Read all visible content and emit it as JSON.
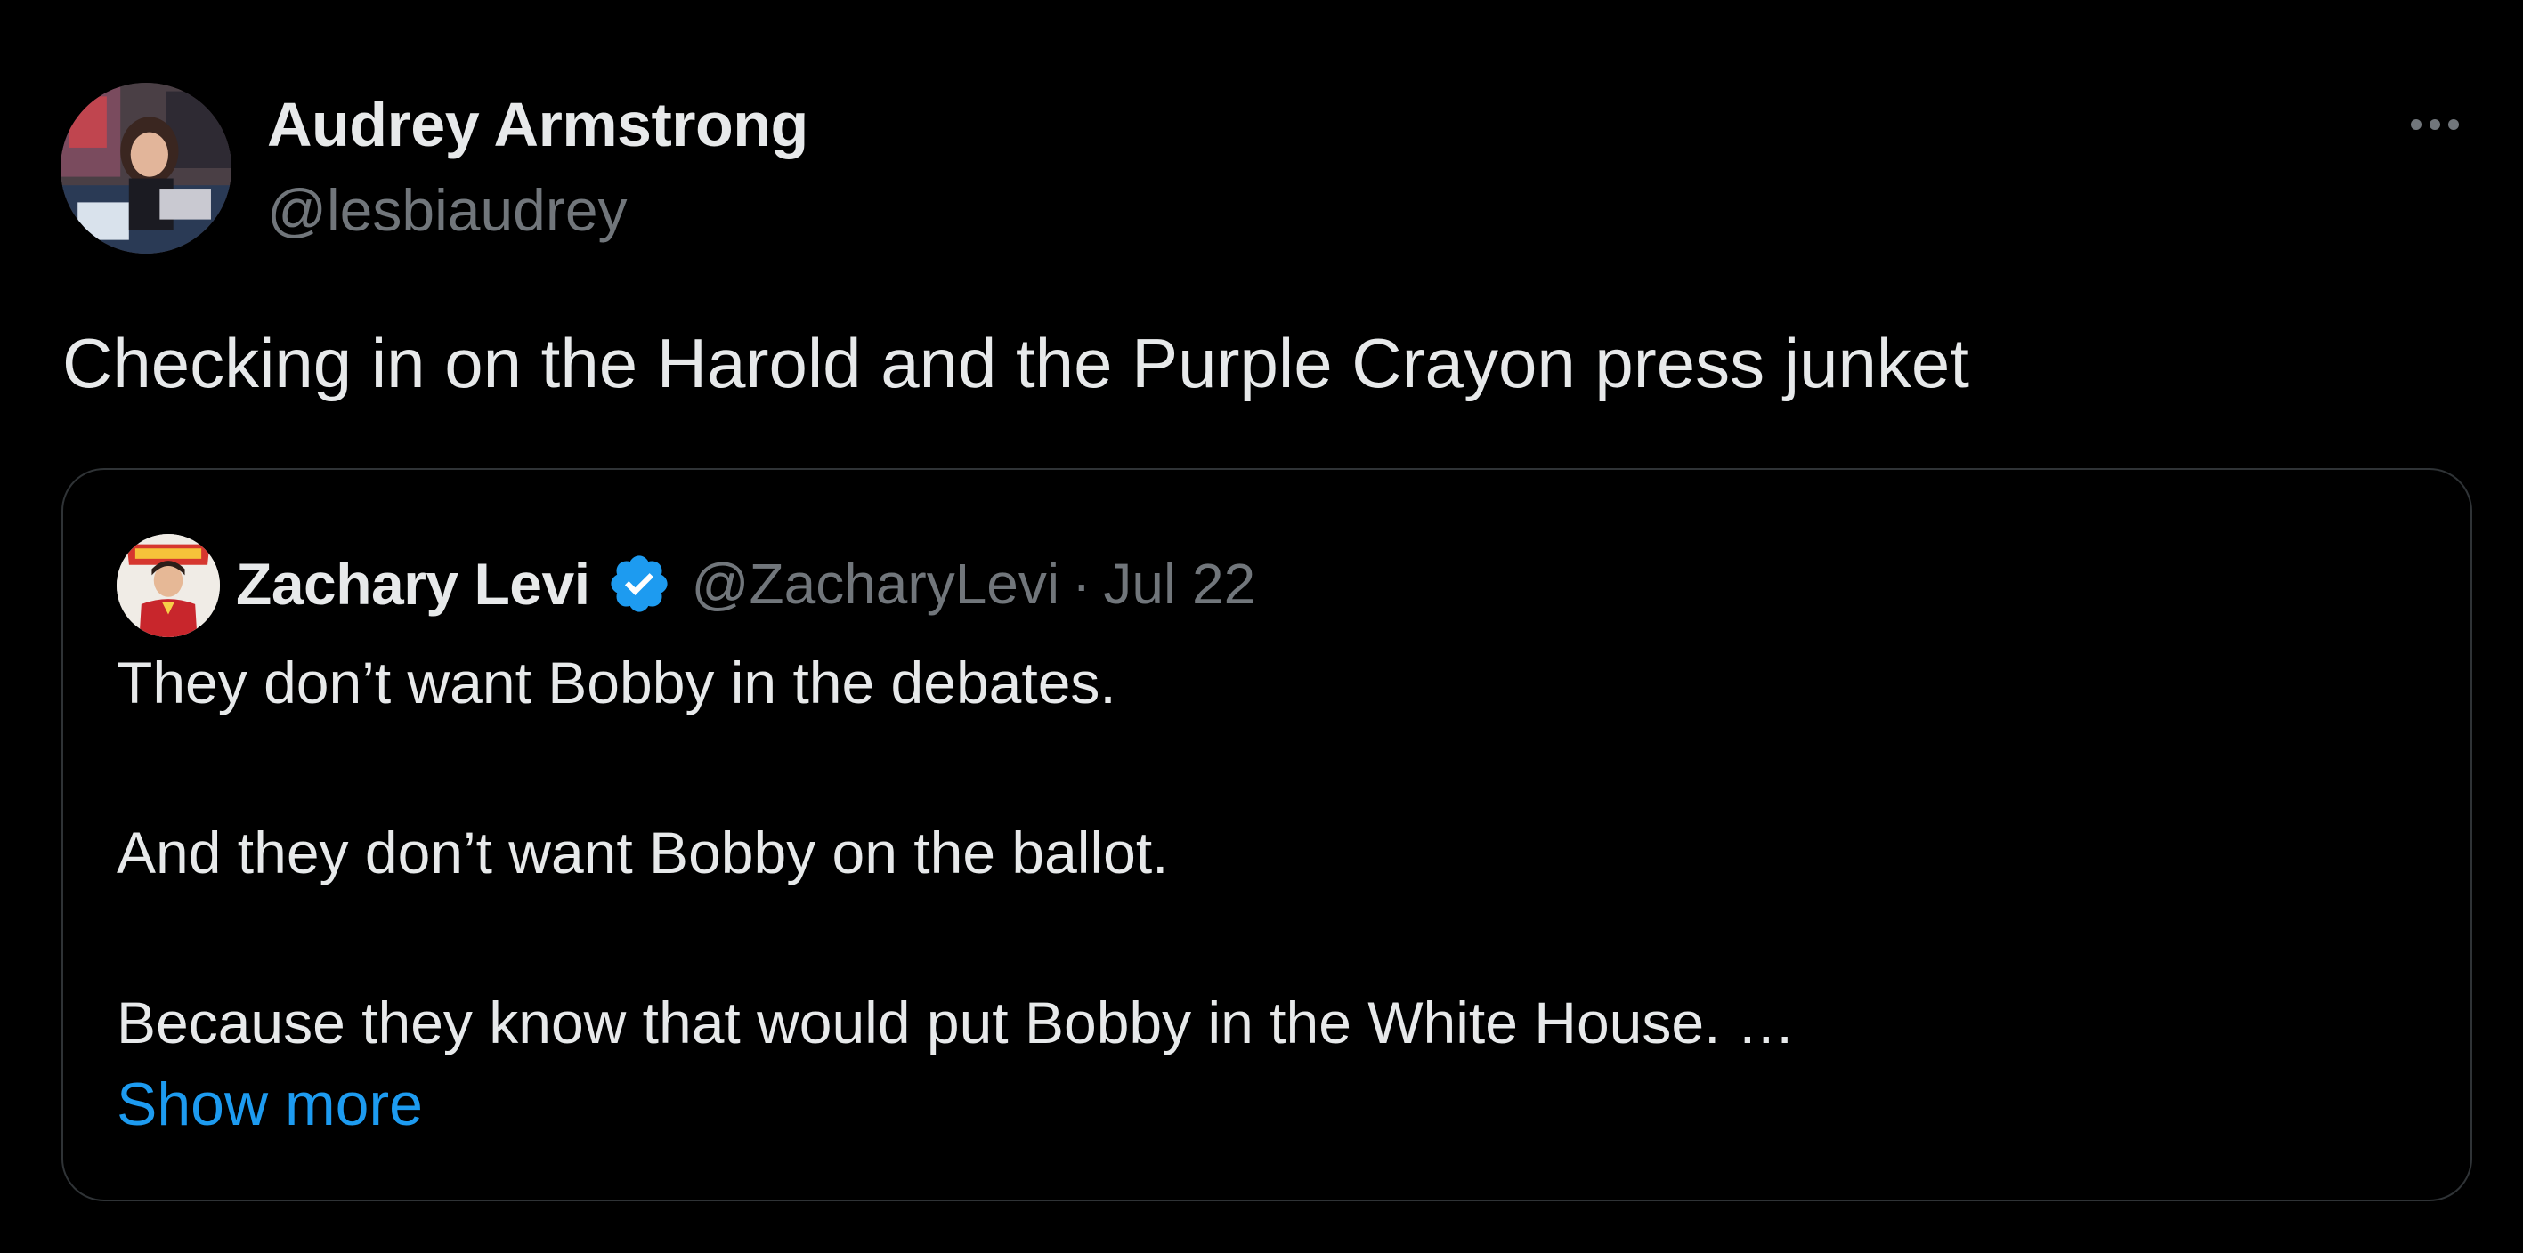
{
  "tweet": {
    "author_name": "Audrey Armstrong",
    "author_handle": "@lesbiaudrey",
    "text": "Checking in on the Harold and the Purple Crayon press junket",
    "more_icon": "more-horizontal-icon"
  },
  "quote": {
    "author_name": "Zachary Levi",
    "verified_icon": "verified-badge-icon",
    "author_handle": "@ZacharyLevi",
    "separator": "·",
    "date": "Jul 22",
    "lines": [
      "They don’t want Bobby in the debates.",
      "And they don’t want Bobby on the ballot.",
      "Because they know that would put Bobby in the White House. …"
    ],
    "show_more": "Show more"
  },
  "colors": {
    "background": "#000000",
    "primary_text": "#e7e9ea",
    "secondary_text": "#71767b",
    "link": "#1d9bf0",
    "border": "#2f3336",
    "verified": "#1d9bf0"
  }
}
